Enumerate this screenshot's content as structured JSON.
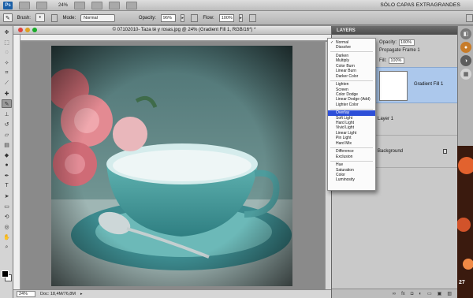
{
  "app_bar": {
    "logo": "Ps",
    "zoom": "24%",
    "workspace": "SÓLO CAPAS EXTRAGRANDES"
  },
  "options_bar": {
    "brush_label": "Brush:",
    "brush_size": "•",
    "mode_label": "Mode:",
    "mode_value": "Normal",
    "opacity_label": "Opacity:",
    "opacity_value": "96%",
    "flow_label": "Flow:",
    "flow_value": "100%"
  },
  "document": {
    "title": "© 07102010- Taza té y rosas.jpg @ 24% (Gradient Fill 1, RGB/16*) *",
    "status_zoom": "24%",
    "status_doc": "Doc: 18,4M/76,8M"
  },
  "layers_panel": {
    "tab": "LAYERS",
    "opacity_label": "Opacity:",
    "opacity_value": "100%",
    "propagate_label": "Propagate Frame 1",
    "fill_label": "Fill:",
    "fill_value": "100%",
    "layers": [
      {
        "name": "Gradient Fill 1"
      },
      {
        "name": "Layer 1"
      },
      {
        "name": "Background"
      }
    ]
  },
  "blend_menu": {
    "checked": "Normal",
    "selected": "Overlay",
    "groups": [
      [
        "Normal",
        "Dissolve"
      ],
      [
        "Darken",
        "Multiply",
        "Color Burn",
        "Linear Burn",
        "Darker Color"
      ],
      [
        "Lighten",
        "Screen",
        "Color Dodge",
        "Linear Dodge (Add)",
        "Lighter Color"
      ],
      [
        "Overlay",
        "Soft Light",
        "Hard Light",
        "Vivid Light",
        "Linear Light",
        "Pin Light",
        "Hard Mix"
      ],
      [
        "Difference",
        "Exclusion"
      ],
      [
        "Hue",
        "Saturation",
        "Color",
        "Luminosity"
      ]
    ]
  },
  "dock_number": "27",
  "icons": [
    "brush-icon",
    "move-icon",
    "lasso-icon",
    "lock-icon"
  ]
}
